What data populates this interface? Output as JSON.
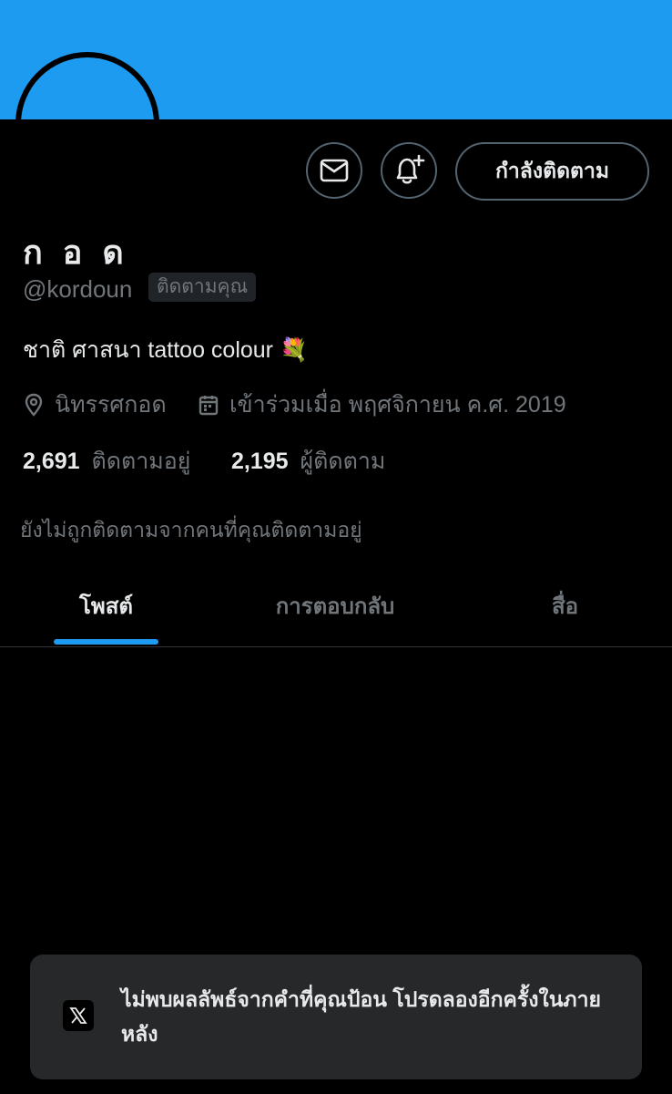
{
  "profile": {
    "name": "ก อ ด",
    "handle": "@kordoun",
    "follows_you_badge": "ติดตามคุณ",
    "bio": "ชาติ ศาสนา tattoo colour 💐",
    "location": "นิทรรศกอด",
    "joined": "เข้าร่วมเมื่อ พฤศจิกายน ค.ศ. 2019",
    "following_count": "2,691",
    "following_label": "ติดตามอยู่",
    "followers_count": "2,195",
    "followers_label": "ผู้ติดตาม",
    "not_followed_note": "ยังไม่ถูกติดตามจากคนที่คุณติดตามอยู่"
  },
  "actions": {
    "message_icon": "envelope-icon",
    "notify_icon": "bell-plus-icon",
    "follow_label": "กำลังติดตาม"
  },
  "tabs": [
    {
      "label": "โพสต์",
      "active": true
    },
    {
      "label": "การตอบกลับ",
      "active": false
    },
    {
      "label": "สื่อ",
      "active": false
    }
  ],
  "toast": {
    "message": "ไม่พบผลลัพธ์จากคำที่คุณป้อน โปรดลองอีกครั้งในภายหลัง",
    "logo_icon": "x-logo-icon"
  },
  "colors": {
    "accent": "#1d9bf0",
    "background": "#000000",
    "text_primary": "#e7e9ea",
    "text_secondary": "#71767b",
    "toast_bg": "#262829"
  }
}
